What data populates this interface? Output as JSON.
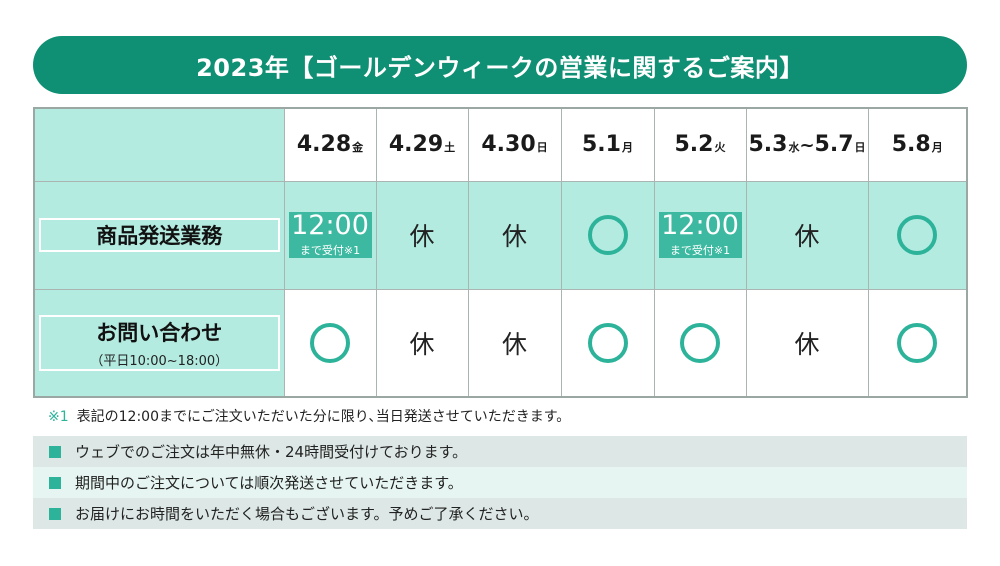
{
  "banner": {
    "title": "2023年【ゴールデンウィークの営業に関するご案内】"
  },
  "dates": [
    {
      "date": "4.28",
      "day": "金"
    },
    {
      "date": "4.29",
      "day": "土"
    },
    {
      "date": "4.30",
      "day": "日"
    },
    {
      "date": "5.1",
      "day": "月"
    },
    {
      "date": "5.2",
      "day": "火"
    },
    {
      "date_start": "5.3",
      "day_start": "水",
      "sep": "~",
      "date_end": "5.7",
      "day_end": "日"
    },
    {
      "date": "5.8",
      "day": "月"
    }
  ],
  "rows": {
    "shipping": {
      "label": "商品発送業務",
      "cells": [
        {
          "time": "12:00",
          "note": "まで受付※1"
        },
        {
          "text": "休"
        },
        {
          "text": "休"
        },
        {
          "symbol": "circle"
        },
        {
          "time": "12:00",
          "note": "まで受付※1"
        },
        {
          "text": "休"
        },
        {
          "symbol": "circle"
        }
      ]
    },
    "inquiry": {
      "label": "お問い合わせ",
      "sub": "（平日10:00~18:00）",
      "cells": [
        {
          "symbol": "circle"
        },
        {
          "text": "休"
        },
        {
          "text": "休"
        },
        {
          "symbol": "circle"
        },
        {
          "symbol": "circle"
        },
        {
          "text": "休"
        },
        {
          "symbol": "circle"
        }
      ]
    }
  },
  "footnote": {
    "mark": "※1",
    "text": "表記の12:00までにご注文いただいた分に限り､当日発送させていただきます。"
  },
  "info": [
    "ウェブでのご注文は年中無休・24時間受付けております。",
    "期間中のご注文については順次発送させていただきます。",
    "お届けにお時間をいただく場合もございます。予めご了承ください。"
  ],
  "colors": {
    "banner": "#0f8f73",
    "accent": "#2cb39a",
    "mint": "#b3ebe1",
    "time_box": "#3cb9a0"
  }
}
